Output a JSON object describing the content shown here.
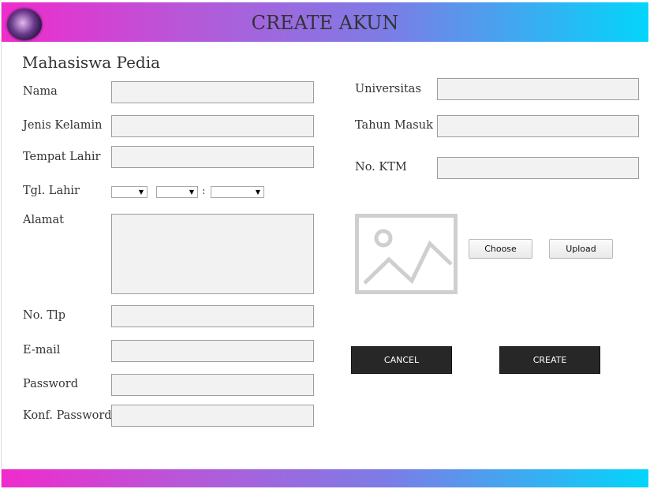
{
  "header": {
    "title": "CREATE AKUN",
    "logo_icon": "logo-icon"
  },
  "app": {
    "title": "Mahasiswa Pedia"
  },
  "form": {
    "nama_label": "Nama",
    "jenis_kelamin_label": "Jenis Kelamin",
    "tempat_lahir_label": "Tempat Lahir",
    "tgl_lahir_label": "Tgl. Lahir",
    "tgl_separator": ":",
    "alamat_label": "Alamat",
    "no_tlp_label": "No. Tlp",
    "email_label": "E-mail",
    "password_label": "Password",
    "konf_password_label": "Konf. Password",
    "universitas_label": "Universitas",
    "tahun_masuk_label": "Tahun Masuk",
    "no_ktm_label": "No. KTM"
  },
  "photo": {
    "placeholder_icon": "image-placeholder-icon",
    "choose_label": "Choose",
    "upload_label": "Upload"
  },
  "actions": {
    "cancel_label": "CANCEL",
    "create_label": "CREATE"
  },
  "colors": {
    "gradient_start": "#f02bcc",
    "gradient_mid": "#7b7de6",
    "gradient_end": "#03d5fb",
    "dark_button": "#272727"
  }
}
